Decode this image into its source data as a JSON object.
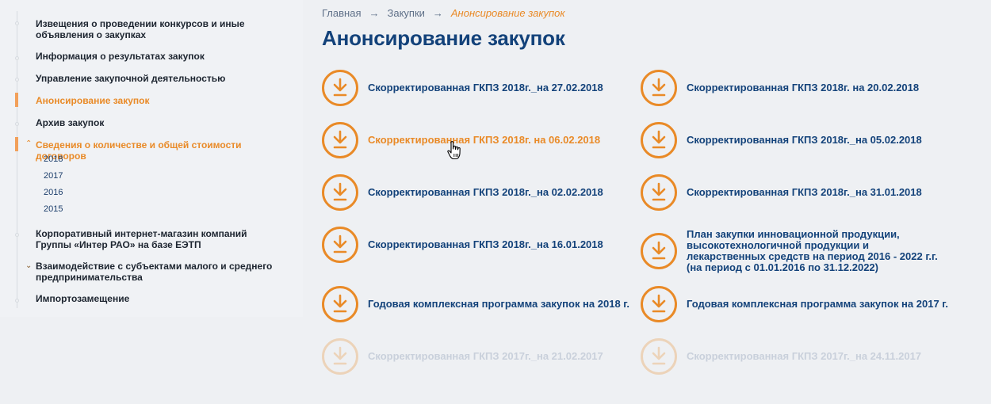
{
  "sidebar": {
    "items": [
      {
        "label": "Извещения о проведении конкурсов и иные объявления о закупках"
      },
      {
        "label": "Информация о результатах закупок"
      },
      {
        "label": "Управление закупочной деятельностью"
      },
      {
        "label": "Анонсирование закупок",
        "active": true
      },
      {
        "label": "Архив закупок"
      },
      {
        "label": "Сведения о количестве и общей стоимости договоров",
        "active": true,
        "expanded": true
      },
      {
        "label": "Корпоративный интернет-магазин компаний Группы «Интер РАО» на базе ЕЭТП"
      },
      {
        "label": "Взаимодействие с субъектами малого и среднего предпринимательства",
        "collapsible": true
      },
      {
        "label": "Импортозамещение"
      }
    ],
    "years": [
      "2018",
      "2017",
      "2016",
      "2015"
    ]
  },
  "breadcrumb": {
    "home": "Главная",
    "section": "Закупки",
    "current": "Анонсирование закупок",
    "separator": "→"
  },
  "page_title": "Анонсирование закупок",
  "documents": [
    {
      "label": "Скорректированная ГКПЗ 2018г._на 27.02.2018"
    },
    {
      "label": "Скорректированная ГКПЗ 2018г. на 20.02.2018"
    },
    {
      "label": "Скорректированная ГКПЗ 2018г. на 06.02.2018",
      "hover": true
    },
    {
      "label": "Скорректированная ГКПЗ 2018г._на 05.02.2018"
    },
    {
      "label": "Скорректированная ГКПЗ 2018г._на 02.02.2018"
    },
    {
      "label": "Скорректированная ГКПЗ 2018г._на 31.01.2018"
    },
    {
      "label": "Скорректированная ГКПЗ 2018г._на 16.01.2018"
    },
    {
      "label": "План закупки инновационной продукции, высокотехнологичной продукции и лекарственных средств на период 2016 - 2022 г.г. (на период с 01.01.2016 по 31.12.2022)"
    },
    {
      "label": "Годовая комплексная программа закупок на 2018 г."
    },
    {
      "label": "Годовая комплексная программа закупок на 2017 г."
    },
    {
      "label": "Скорректированная ГКПЗ 2017г._на 21.02.2017"
    },
    {
      "label": "Скорректированная ГКПЗ 2017г._на 24.11.2017"
    }
  ],
  "colors": {
    "accent": "#e98a27",
    "link": "#13427a",
    "background": "#eef0f3"
  },
  "icons": {
    "document": "download-icon",
    "cursor": "hand-pointer-icon"
  }
}
